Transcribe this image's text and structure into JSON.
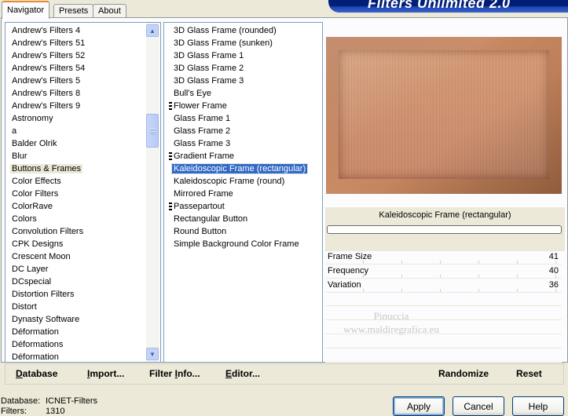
{
  "app": {
    "title": "Filters Unlimited 2.0"
  },
  "tabs": [
    {
      "label": "Navigator",
      "active": true
    },
    {
      "label": "Presets",
      "active": false
    },
    {
      "label": "About",
      "active": false
    }
  ],
  "categories": [
    "Andrew's Filters 4",
    "Andrew's Filters 51",
    "Andrew's Filters 52",
    "Andrew's Filters 54",
    "Andrew's Filters 5",
    "Andrew's Filters 8",
    "Andrew's Filters 9",
    "Astronomy",
    "a",
    "Balder Olrik",
    "Blur",
    "Buttons & Frames",
    "Color Effects",
    "Color Filters",
    "ColorRave",
    "Colors",
    "Convolution Filters",
    "CPK Designs",
    "Crescent Moon",
    "DC Layer",
    "DCspecial",
    "Distortion Filters",
    "Distort",
    "Dynasty Software",
    "Déformation",
    "Déformations",
    "Déformation"
  ],
  "selected_category": "Buttons & Frames",
  "filters": [
    {
      "label": "3D Glass Frame (rounded)",
      "group": false
    },
    {
      "label": "3D Glass Frame (sunken)",
      "group": false
    },
    {
      "label": "3D Glass Frame 1",
      "group": false
    },
    {
      "label": "3D Glass Frame 2",
      "group": false
    },
    {
      "label": "3D Glass Frame 3",
      "group": false
    },
    {
      "label": "Bull's Eye",
      "group": false
    },
    {
      "label": "Flower Frame",
      "group": true
    },
    {
      "label": "Glass Frame 1",
      "group": false
    },
    {
      "label": "Glass Frame 2",
      "group": false
    },
    {
      "label": "Glass Frame 3",
      "group": false
    },
    {
      "label": "Gradient Frame",
      "group": true
    },
    {
      "label": "Kaleidoscopic Frame (rectangular)",
      "group": false
    },
    {
      "label": "Kaleidoscopic Frame (round)",
      "group": false
    },
    {
      "label": "Mirrored Frame",
      "group": false
    },
    {
      "label": "Passepartout",
      "group": true
    },
    {
      "label": "Rectangular Button",
      "group": false
    },
    {
      "label": "Round Button",
      "group": false
    },
    {
      "label": "Simple Background Color Frame",
      "group": false
    }
  ],
  "selected_filter": "Kaleidoscopic Frame (rectangular)",
  "preview": {
    "caption": "Kaleidoscopic Frame (rectangular)",
    "progress": 0,
    "colors": {
      "frame": "#b97a55",
      "inner": "#d49a75"
    }
  },
  "parameters": [
    {
      "name": "Frame Size",
      "value": "41"
    },
    {
      "name": "Frequency",
      "value": "40"
    },
    {
      "name": "Variation",
      "value": "36"
    }
  ],
  "watermark": {
    "line1": "Pinuccia",
    "line2": "www.maldiregrafica.eu"
  },
  "toolbar": {
    "database": {
      "acc": "D",
      "rest": "atabase"
    },
    "import": {
      "acc": "I",
      "rest": "mport..."
    },
    "filter_info": {
      "pre": "Filter ",
      "acc": "I",
      "rest": "nfo..."
    },
    "editor": {
      "acc": "E",
      "rest": "ditor..."
    },
    "randomize": "Randomize",
    "reset": "Reset"
  },
  "status": {
    "database_label": "Database:",
    "database_value": "ICNET-Filters",
    "filters_label": "Filters:",
    "filters_value": "1310"
  },
  "buttons": {
    "apply": "Apply",
    "cancel": "Cancel",
    "help": "Help"
  },
  "colors": {
    "selection": "#316ac5",
    "window_bg": "#ece9d8",
    "title_bar": "#001e78"
  }
}
